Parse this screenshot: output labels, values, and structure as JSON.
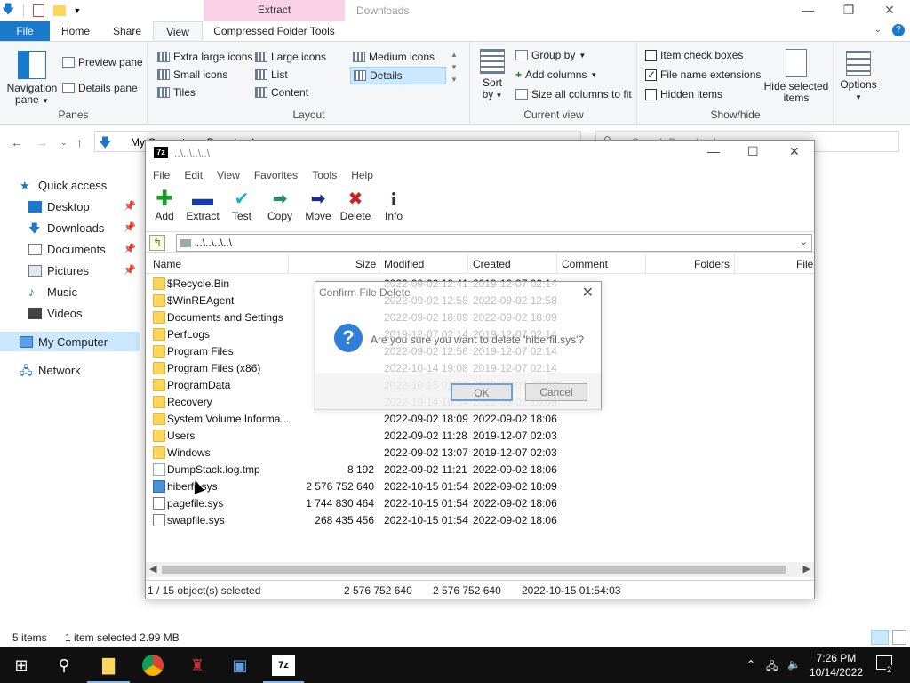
{
  "explorer": {
    "title": "Downloads",
    "extract_tab_header": "Extract",
    "tabs": [
      "File",
      "Home",
      "Share",
      "View",
      "Compressed Folder Tools"
    ],
    "ribbon": {
      "panes": {
        "label": "Panes",
        "navigation_pane": "Navigation pane",
        "preview_pane": "Preview pane",
        "details_pane": "Details pane"
      },
      "layout": {
        "label": "Layout",
        "items": [
          "Extra large icons",
          "Large icons",
          "Medium icons",
          "Small icons",
          "List",
          "Details",
          "Tiles",
          "Content"
        ]
      },
      "current_view": {
        "label": "Current view",
        "sort_by": "Sort by",
        "group_by": "Group by",
        "add_columns": "Add columns",
        "size_all_columns": "Size all columns to fit"
      },
      "show_hide": {
        "label": "Show/hide",
        "item_check_boxes": "Item check boxes",
        "file_name_extensions": "File name extensions",
        "hidden_items": "Hidden items",
        "hide_selected": "Hide selected items"
      },
      "options": "Options"
    },
    "address": "My Computer > Downloads",
    "search_placeholder": "Search Downloads",
    "nav": [
      {
        "label": "Quick access"
      },
      {
        "label": "Desktop"
      },
      {
        "label": "Downloads"
      },
      {
        "label": "Documents"
      },
      {
        "label": "Pictures"
      },
      {
        "label": "Music"
      },
      {
        "label": "Videos"
      },
      {
        "label": "My Computer"
      },
      {
        "label": "Network"
      }
    ],
    "status_items": "5 items",
    "status_selected": "1 item selected  2.99 MB"
  },
  "sevenzip": {
    "title_path": "..\\..\\..\\..\\",
    "menu": [
      "File",
      "Edit",
      "View",
      "Favorites",
      "Tools",
      "Help"
    ],
    "toolbar": [
      "Add",
      "Extract",
      "Test",
      "Copy",
      "Move",
      "Delete",
      "Info"
    ],
    "path": "..\\..\\..\\..\\",
    "columns": [
      "Name",
      "Size",
      "Modified",
      "Created",
      "Comment",
      "Folders",
      "File"
    ],
    "rows": [
      {
        "name": "$Recycle.Bin",
        "size": "",
        "modified": "2022-09-02 12:41",
        "created": "2019-12-07 02:14",
        "type": "folder"
      },
      {
        "name": "$WinREAgent",
        "size": "",
        "modified": "2022-09-02 12:58",
        "created": "2022-09-02 12:58",
        "type": "folder"
      },
      {
        "name": "Documents and Settings",
        "size": "",
        "modified": "2022-09-02 18:09",
        "created": "2022-09-02 18:09",
        "type": "folder"
      },
      {
        "name": "PerfLogs",
        "size": "",
        "modified": "2019-12-07 02:14",
        "created": "2019-12-07 02:14",
        "type": "folder"
      },
      {
        "name": "Program Files",
        "size": "",
        "modified": "2022-09-02 12:56",
        "created": "2019-12-07 02:14",
        "type": "folder"
      },
      {
        "name": "Program Files (x86)",
        "size": "",
        "modified": "2022-10-14 19:08",
        "created": "2019-12-07 02:14",
        "type": "folder"
      },
      {
        "name": "ProgramData",
        "size": "",
        "modified": "2022-10-15 01:54",
        "created": "2019-12-07 02:14",
        "type": "folder"
      },
      {
        "name": "Recovery",
        "size": "",
        "modified": "2022-10-14 18:54",
        "created": "2022-09-02 18:09",
        "type": "folder"
      },
      {
        "name": "System Volume Informa...",
        "size": "",
        "modified": "2022-09-02 18:09",
        "created": "2022-09-02 18:06",
        "type": "folder"
      },
      {
        "name": "Users",
        "size": "",
        "modified": "2022-09-02 11:28",
        "created": "2019-12-07 02:03",
        "type": "folder"
      },
      {
        "name": "Windows",
        "size": "",
        "modified": "2022-09-02 13:07",
        "created": "2019-12-07 02:03",
        "type": "folder"
      },
      {
        "name": "DumpStack.log.tmp",
        "size": "8 192",
        "modified": "2022-09-02 11:21",
        "created": "2022-09-02 18:06",
        "type": "file"
      },
      {
        "name": "hiberfil.sys",
        "size": "2 576 752 640",
        "modified": "2022-10-15 01:54",
        "created": "2022-09-02 18:09",
        "type": "sysb"
      },
      {
        "name": "pagefile.sys",
        "size": "1 744 830 464",
        "modified": "2022-10-15 01:54",
        "created": "2022-09-02 18:06",
        "type": "sysf"
      },
      {
        "name": "swapfile.sys",
        "size": "268 435 456",
        "modified": "2022-10-15 01:54",
        "created": "2022-09-02 18:06",
        "type": "sysf"
      }
    ],
    "status": {
      "selected": "1 / 15 object(s) selected",
      "size": "2 576 752 640",
      "packed": "2 576 752 640",
      "modified": "2022-10-15 01:54:03"
    }
  },
  "confirm_dialog": {
    "title": "Confirm File Delete",
    "message": "Are you sure you want to delete 'hiberfil.sys'?",
    "ok": "OK",
    "cancel": "Cancel"
  },
  "taskbar": {
    "time": "7:26 PM",
    "date": "10/14/2022",
    "notification_count": "2"
  }
}
